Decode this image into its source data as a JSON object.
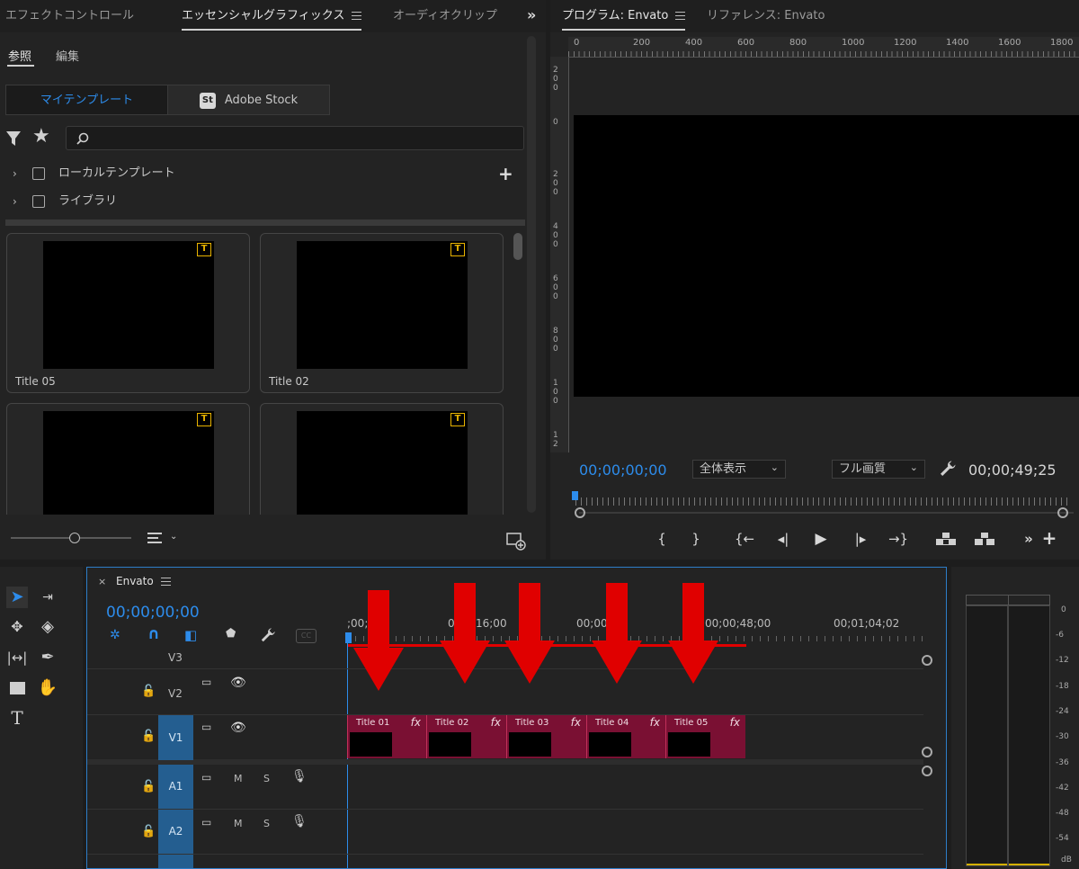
{
  "left_panel": {
    "tabs": [
      "エフェクトコントロール",
      "エッセンシャルグラフィックス",
      "オーディオクリップ"
    ],
    "active_tab_index": 1,
    "subtabs": [
      "参照",
      "編集"
    ],
    "segments": {
      "my_templates": "マイテンプレート",
      "adobe_stock_badge": "St",
      "adobe_stock": "Adobe Stock"
    },
    "search": {
      "placeholder": ""
    },
    "tree": [
      "ローカルテンプレート",
      "ライブラリ"
    ],
    "cards": [
      "Title 05",
      "Title 02",
      "",
      ""
    ],
    "accent": "#2d8ceb",
    "badge_color": "#e8b300"
  },
  "program_monitor": {
    "tabs": [
      "プログラム: Envato",
      "リファレンス: Envato"
    ],
    "ruler_top": [
      "0",
      "200",
      "400",
      "600",
      "800",
      "1000",
      "1200",
      "1400",
      "1600",
      "1800"
    ],
    "ruler_left": [
      [
        "2",
        "0",
        "0"
      ],
      [
        "0"
      ],
      [
        "2",
        "0",
        "0"
      ],
      [
        "4",
        "0",
        "0"
      ],
      [
        "6",
        "0",
        "0"
      ],
      [
        "8",
        "0",
        "0"
      ],
      [
        "1",
        "0",
        "0"
      ],
      [
        "1",
        "2"
      ]
    ],
    "timecode_current": "00;00;00;00",
    "zoom_select": "全体表示",
    "quality_select": "フル画質",
    "timecode_duration": "00;00;49;25"
  },
  "timeline": {
    "sequence_name": "Envato",
    "timecode": "00;00;00;00",
    "ruler_labels": [
      ";00;0",
      "0;00;16;00",
      "00;00;",
      "00;00;48;00",
      "00;01;04;02"
    ],
    "video_tracks": [
      "V3",
      "V2",
      "V1"
    ],
    "audio_tracks": [
      "A1",
      "A2"
    ],
    "track_buttons": {
      "mute": "M",
      "solo": "S"
    },
    "clips": [
      {
        "name": "Title 01",
        "fx": "fx"
      },
      {
        "name": "Title 02",
        "fx": "fx"
      },
      {
        "name": "Title 03",
        "fx": "fx"
      },
      {
        "name": "Title 04",
        "fx": "fx"
      },
      {
        "name": "Title 05",
        "fx": "fx"
      }
    ],
    "clip_color": "#7a1033",
    "arrow_color": "#e00000"
  },
  "audio_meter": {
    "labels": [
      "0",
      "-6",
      "-12",
      "-18",
      "-24",
      "-30",
      "-36",
      "-42",
      "-48",
      "-54",
      "dB"
    ]
  }
}
